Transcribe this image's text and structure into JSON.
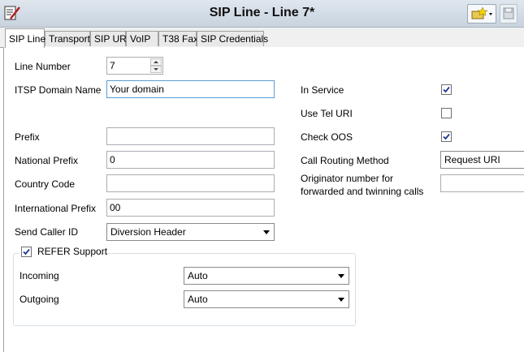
{
  "window": {
    "title": "SIP Line - Line 7*"
  },
  "tabs": [
    {
      "label": "SIP Line",
      "active": true
    },
    {
      "label": "Transport",
      "active": false
    },
    {
      "label": "SIP URI",
      "active": false
    },
    {
      "label": "VoIP",
      "active": false
    },
    {
      "label": "T38 Fax",
      "active": false
    },
    {
      "label": "SIP Credentials",
      "active": false
    }
  ],
  "left": {
    "line_number": {
      "label": "Line Number",
      "value": "7"
    },
    "itsp_domain": {
      "label": "ITSP Domain Name",
      "value": "Your domain"
    },
    "prefix": {
      "label": "Prefix",
      "value": ""
    },
    "national_prefix": {
      "label": "National Prefix",
      "value": "0"
    },
    "country_code": {
      "label": "Country Code",
      "value": ""
    },
    "international_prefix": {
      "label": "International Prefix",
      "value": "00"
    },
    "send_caller_id": {
      "label": "Send Caller ID",
      "value": "Diversion Header"
    }
  },
  "right": {
    "in_service": {
      "label": "In Service",
      "checked": true
    },
    "use_tel_uri": {
      "label": "Use Tel URI",
      "checked": false
    },
    "check_oos": {
      "label": "Check OOS",
      "checked": true
    },
    "call_routing": {
      "label": "Call Routing Method",
      "value": "Request URI"
    },
    "originator": {
      "label_line1": "Originator number for",
      "label_line2": "forwarded and twinning calls",
      "value": ""
    }
  },
  "refer": {
    "label": "REFER Support",
    "checked": true,
    "incoming": {
      "label": "Incoming",
      "value": "Auto"
    },
    "outgoing": {
      "label": "Outgoing",
      "value": "Auto"
    }
  }
}
